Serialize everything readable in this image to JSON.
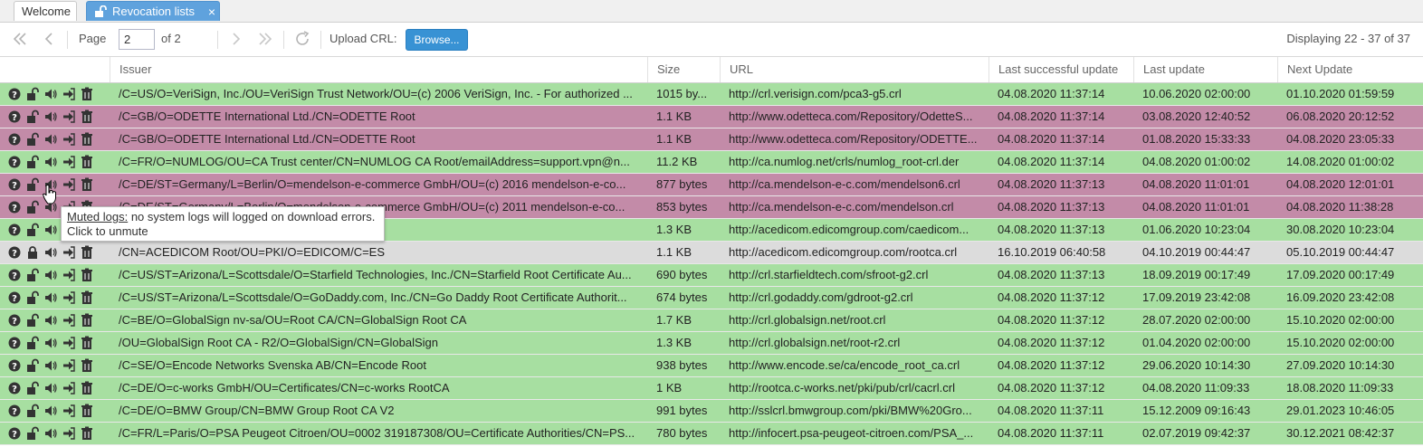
{
  "tabs": {
    "welcome": "Welcome",
    "active": "Revocation lists",
    "close": "×"
  },
  "toolbar": {
    "page_label": "Page",
    "page_value": "2",
    "of_label": "of 2",
    "upload_label": "Upload CRL:",
    "browse_label": "Browse...",
    "displaying": "Displaying 22 - 37 of 37"
  },
  "columns": {
    "issuer": "Issuer",
    "size": "Size",
    "url": "URL",
    "last_success": "Last successful update",
    "last_update": "Last update",
    "next_update": "Next Update"
  },
  "rows": [
    {
      "status": "green",
      "issuer": "/C=US/O=VeriSign, Inc./OU=VeriSign Trust Network/OU=(c) 2006 VeriSign, Inc. - For authorized ...",
      "size": "1015 by...",
      "url": "http://crl.verisign.com/pca3-g5.crl",
      "last_success": "04.08.2020 11:37:14",
      "last_update": "10.06.2020 02:00:00",
      "next_update": "01.10.2020 01:59:59"
    },
    {
      "status": "purple",
      "issuer": "/C=GB/O=ODETTE International Ltd./CN=ODETTE Root",
      "size": "1.1 KB",
      "url": "http://www.odetteca.com/Repository/OdetteS...",
      "last_success": "04.08.2020 11:37:14",
      "last_update": "03.08.2020 12:40:52",
      "next_update": "06.08.2020 20:12:52"
    },
    {
      "status": "purple",
      "issuer": "/C=GB/O=ODETTE International Ltd./CN=ODETTE Root",
      "size": "1.1 KB",
      "url": "http://www.odetteca.com/Repository/ODETTE...",
      "last_success": "04.08.2020 11:37:14",
      "last_update": "01.08.2020 15:33:33",
      "next_update": "04.08.2020 23:05:33"
    },
    {
      "status": "green",
      "issuer": "/C=FR/O=NUMLOG/OU=CA Trust center/CN=NUMLOG CA Root/emailAddress=support.vpn@n...",
      "size": "11.2 KB",
      "url": "http://ca.numlog.net/crls/numlog_root-crl.der",
      "last_success": "04.08.2020 11:37:14",
      "last_update": "04.08.2020 01:00:02",
      "next_update": "14.08.2020 01:00:02"
    },
    {
      "status": "purple",
      "issuer": "/C=DE/ST=Germany/L=Berlin/O=mendelson-e-commerce GmbH/OU=(c) 2016 mendelson-e-co...",
      "size": "877 bytes",
      "url": "http://ca.mendelson-e-c.com/mendelson6.crl",
      "last_success": "04.08.2020 11:37:13",
      "last_update": "04.08.2020 11:01:01",
      "next_update": "04.08.2020 12:01:01"
    },
    {
      "status": "purple",
      "issuer": "/C=DE/ST=Germany/L=Berlin/O=mendelson-e-commerce GmbH/OU=(c) 2011 mendelson-e-co...",
      "size": "853 bytes",
      "url": "http://ca.mendelson-e-c.com/mendelson.crl",
      "last_success": "04.08.2020 11:37:13",
      "last_update": "04.08.2020 11:01:01",
      "next_update": "04.08.2020 11:38:28"
    },
    {
      "status": "green",
      "issuer": "",
      "size": "1.3 KB",
      "url": "http://acedicom.edicomgroup.com/caedicom...",
      "last_success": "04.08.2020 11:37:13",
      "last_update": "01.06.2020 10:23:04",
      "next_update": "30.08.2020 10:23:04"
    },
    {
      "status": "grey",
      "issuer": "/CN=ACEDICOM Root/OU=PKI/O=EDICOM/C=ES",
      "size": "1.1 KB",
      "url": "http://acedicom.edicomgroup.com/rootca.crl",
      "last_success": "16.10.2019 06:40:58",
      "last_update": "04.10.2019 00:44:47",
      "next_update": "05.10.2019 00:44:47"
    },
    {
      "status": "green",
      "issuer": "/C=US/ST=Arizona/L=Scottsdale/O=Starfield Technologies, Inc./CN=Starfield Root Certificate Au...",
      "size": "690 bytes",
      "url": "http://crl.starfieldtech.com/sfroot-g2.crl",
      "last_success": "04.08.2020 11:37:13",
      "last_update": "18.09.2019 00:17:49",
      "next_update": "17.09.2020 00:17:49"
    },
    {
      "status": "green",
      "issuer": "/C=US/ST=Arizona/L=Scottsdale/O=GoDaddy.com, Inc./CN=Go Daddy Root Certificate Authorit...",
      "size": "674 bytes",
      "url": "http://crl.godaddy.com/gdroot-g2.crl",
      "last_success": "04.08.2020 11:37:12",
      "last_update": "17.09.2019 23:42:08",
      "next_update": "16.09.2020 23:42:08"
    },
    {
      "status": "green",
      "issuer": "/C=BE/O=GlobalSign nv-sa/OU=Root CA/CN=GlobalSign Root CA",
      "size": "1.7 KB",
      "url": "http://crl.globalsign.net/root.crl",
      "last_success": "04.08.2020 11:37:12",
      "last_update": "28.07.2020 02:00:00",
      "next_update": "15.10.2020 02:00:00"
    },
    {
      "status": "green",
      "issuer": "/OU=GlobalSign Root CA - R2/O=GlobalSign/CN=GlobalSign",
      "size": "1.3 KB",
      "url": "http://crl.globalsign.net/root-r2.crl",
      "last_success": "04.08.2020 11:37:12",
      "last_update": "01.04.2020 02:00:00",
      "next_update": "15.10.2020 02:00:00"
    },
    {
      "status": "green",
      "issuer": "/C=SE/O=Encode Networks Svenska AB/CN=Encode Root",
      "size": "938 bytes",
      "url": "http://www.encode.se/ca/encode_root_ca.crl",
      "last_success": "04.08.2020 11:37:12",
      "last_update": "29.06.2020 10:14:30",
      "next_update": "27.09.2020 10:14:30"
    },
    {
      "status": "green",
      "issuer": "/C=DE/O=c-works GmbH/OU=Certificates/CN=c-works RootCA",
      "size": "1 KB",
      "url": "http://rootca.c-works.net/pki/pub/crl/cacrl.crl",
      "last_success": "04.08.2020 11:37:12",
      "last_update": "04.08.2020 11:09:33",
      "next_update": "18.08.2020 11:09:33"
    },
    {
      "status": "green",
      "issuer": "/C=DE/O=BMW Group/CN=BMW Group Root CA V2",
      "size": "991 bytes",
      "url": "http://sslcrl.bmwgroup.com/pki/BMW%20Gro...",
      "last_success": "04.08.2020 11:37:11",
      "last_update": "15.12.2009 09:16:43",
      "next_update": "29.01.2023 10:46:05"
    },
    {
      "status": "green",
      "issuer": "/C=FR/L=Paris/O=PSA Peugeot Citroen/OU=0002 319187308/OU=Certificate Authorities/CN=PS...",
      "size": "780 bytes",
      "url": "http://infocert.psa-peugeot-citroen.com/PSA_...",
      "last_success": "04.08.2020 11:37:11",
      "last_update": "02.07.2019 09:42:37",
      "next_update": "30.12.2021 08:42:37"
    }
  ],
  "tooltip": {
    "title": "Muted logs:",
    "text": " no system logs will logged on download errors.",
    "line2": "Click to unmute"
  },
  "colors": {
    "green_row": "#a7dfa1",
    "purple_row": "#c38ba8",
    "grey_row": "#dcdcdc",
    "accent": "#5fa2dd"
  }
}
